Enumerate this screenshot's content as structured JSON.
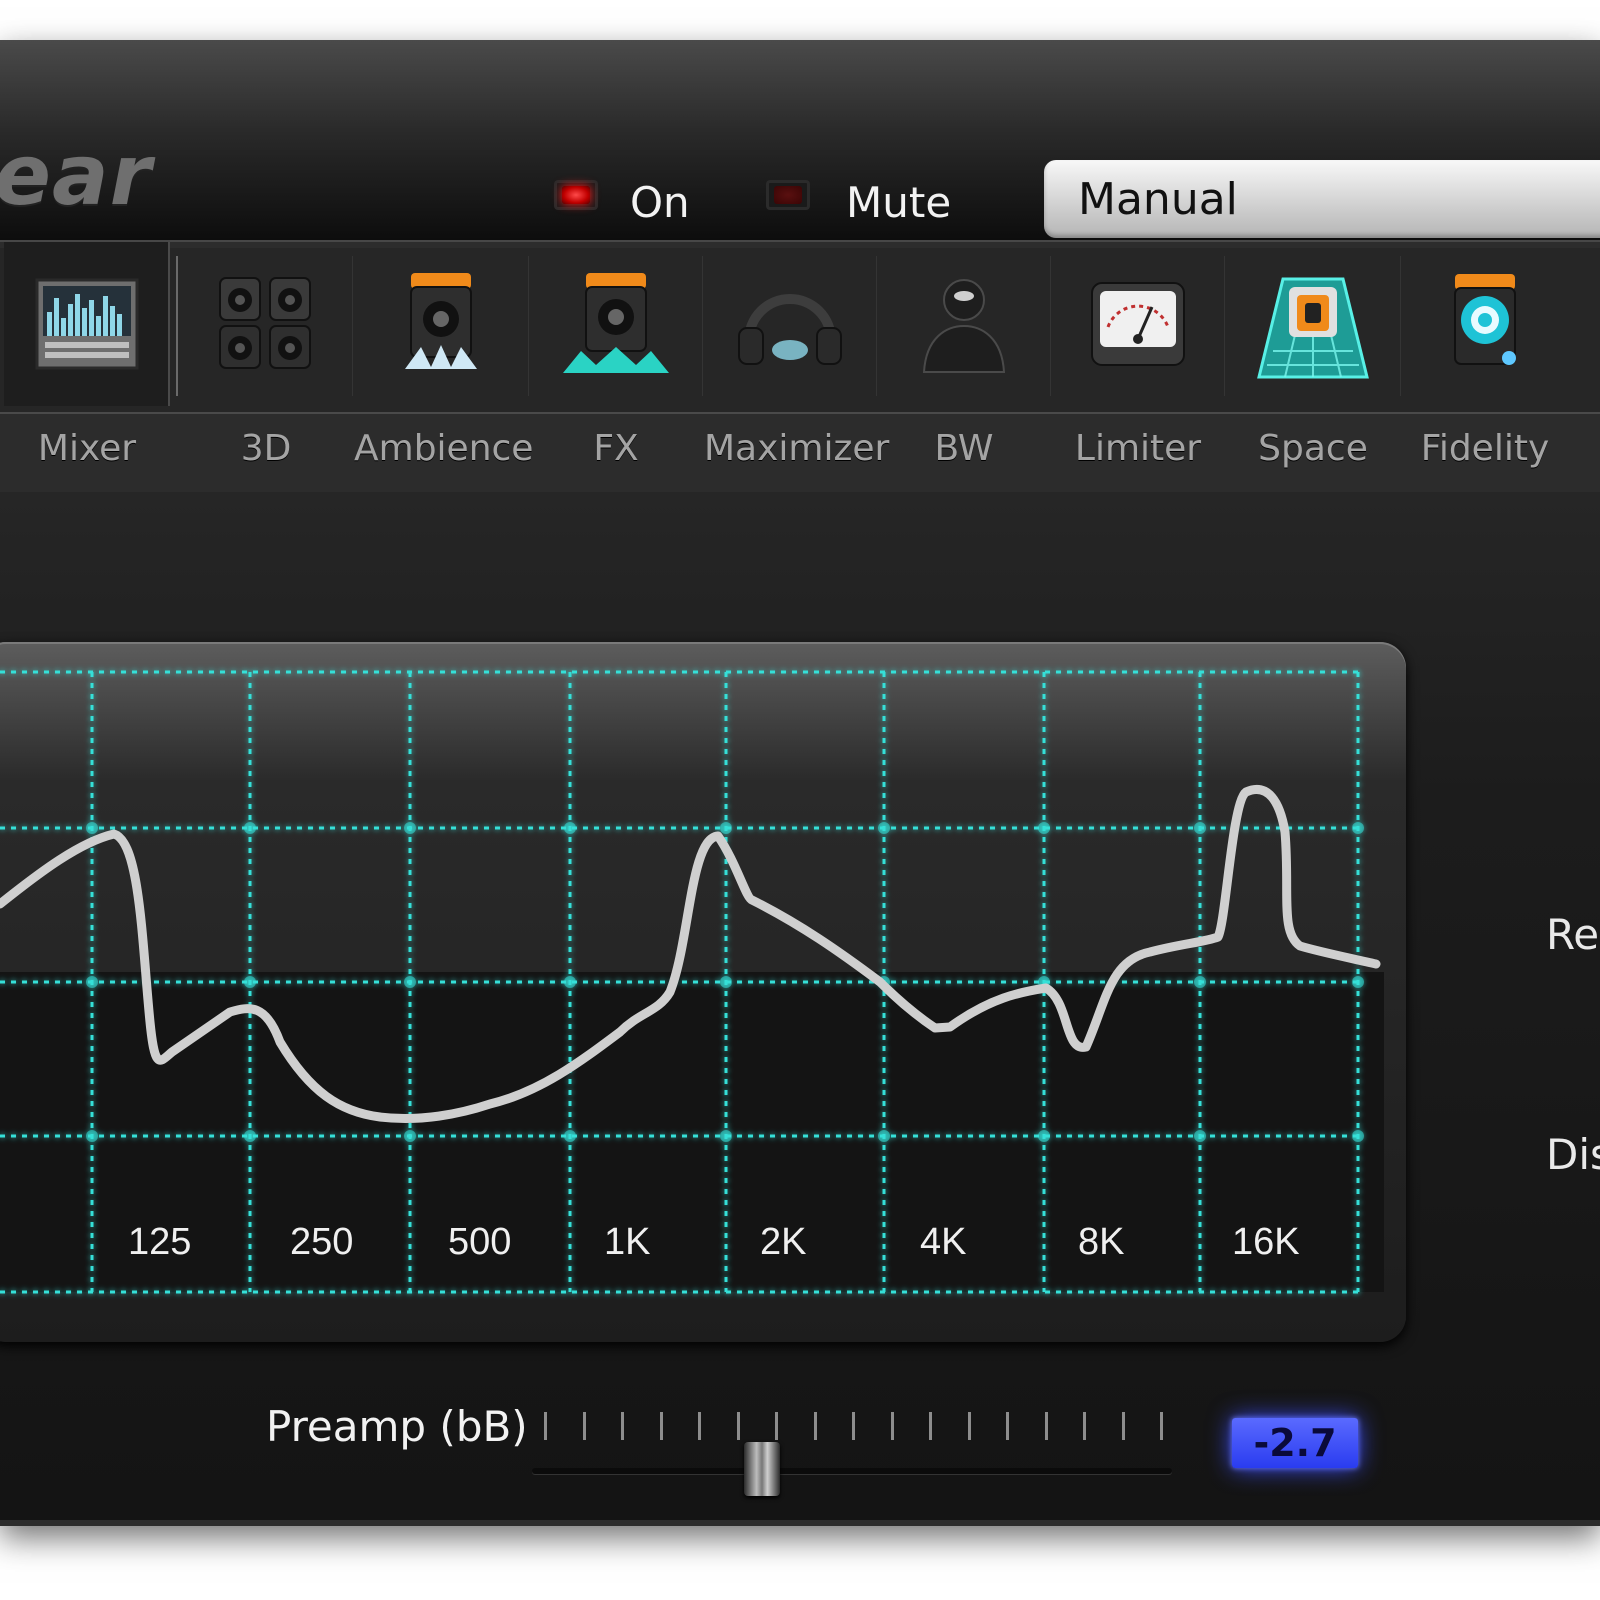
{
  "header": {
    "logo_text": "ear",
    "on_label": "On",
    "mute_label": "Mute",
    "preset_value": "Manual",
    "colors": {
      "on_led": "#e00000",
      "mute_led": "#3a0505",
      "preset_bg": "#d9d9d9"
    }
  },
  "toolbar": {
    "items": [
      {
        "label": "Mixer",
        "icon": "mixer-icon",
        "selected": true
      },
      {
        "label": "3D",
        "icon": "speakers-3d-icon"
      },
      {
        "label": "Ambience",
        "icon": "ambience-speaker-icon"
      },
      {
        "label": "FX",
        "icon": "fx-speaker-icon"
      },
      {
        "label": "Maximizer",
        "icon": "headphones-icon"
      },
      {
        "label": "BW",
        "icon": "person-bust-icon"
      },
      {
        "label": "Limiter",
        "icon": "vu-meter-icon"
      },
      {
        "label": "Space",
        "icon": "space-room-icon"
      },
      {
        "label": "Fidelity",
        "icon": "fidelity-lens-icon"
      }
    ]
  },
  "eq": {
    "band_labels": [
      "125",
      "250",
      "500",
      "1K",
      "2K",
      "4K",
      "8K",
      "16K"
    ],
    "grid_color": "#34e0d8",
    "curve_color": "#cfcfcf"
  },
  "side_labels": {
    "res": "Res",
    "dis": "Dis"
  },
  "preamp": {
    "label": "Preamp (bB)",
    "value": "-2.7",
    "slider_position_fraction": 0.36,
    "value_bg": "#2a3cf0"
  }
}
